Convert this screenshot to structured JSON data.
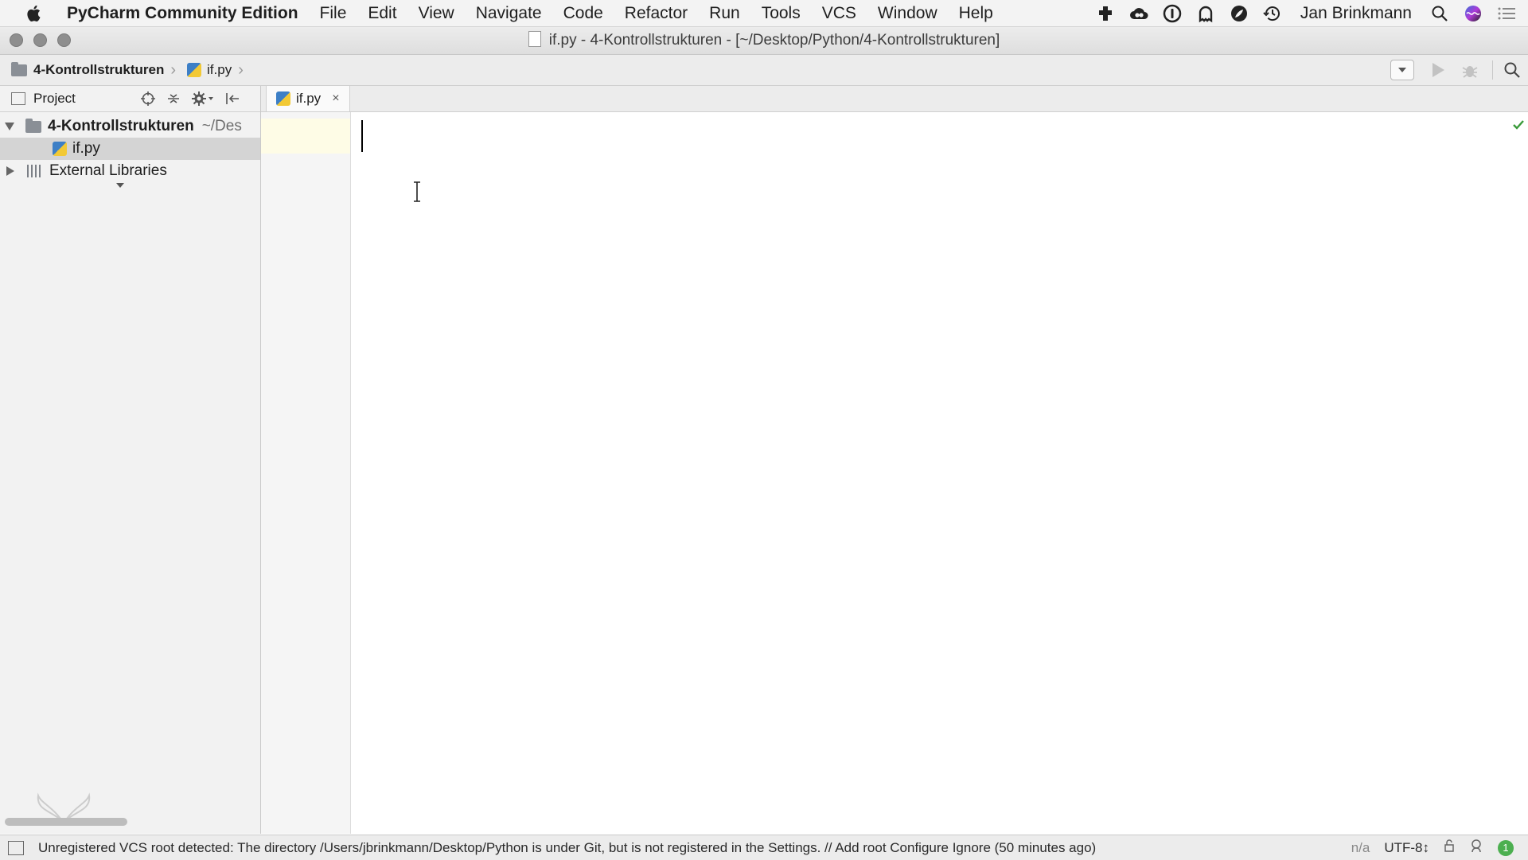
{
  "menubar": {
    "app_name": "PyCharm Community Edition",
    "items": [
      "File",
      "Edit",
      "View",
      "Navigate",
      "Code",
      "Refactor",
      "Run",
      "Tools",
      "VCS",
      "Window",
      "Help"
    ],
    "user": "Jan Brinkmann"
  },
  "window": {
    "title": "if.py - 4-Kontrollstrukturen - [~/Desktop/Python/4-Kontrollstrukturen]"
  },
  "navbar": {
    "crumbs": [
      "4-Kontrollstrukturen",
      "if.py"
    ]
  },
  "project": {
    "view_label": "Project",
    "tree": {
      "root_name": "4-Kontrollstrukturen",
      "root_path": "~/Des",
      "file": "if.py",
      "libraries": "External Libraries"
    }
  },
  "editor": {
    "tab_label": "if.py"
  },
  "statusbar": {
    "message": "Unregistered VCS root detected: The directory /Users/jbrinkmann/Desktop/Python is under Git, but is not registered in the Settings. // Add root  Configure  Ignore (50 minutes ago)",
    "position": "n/a",
    "encoding": "UTF-8↕",
    "notification_count": "1"
  },
  "colors": {
    "current_line": "#fefce6",
    "selection": "#d4d4d4",
    "ok_check": "#3a9a3a"
  }
}
